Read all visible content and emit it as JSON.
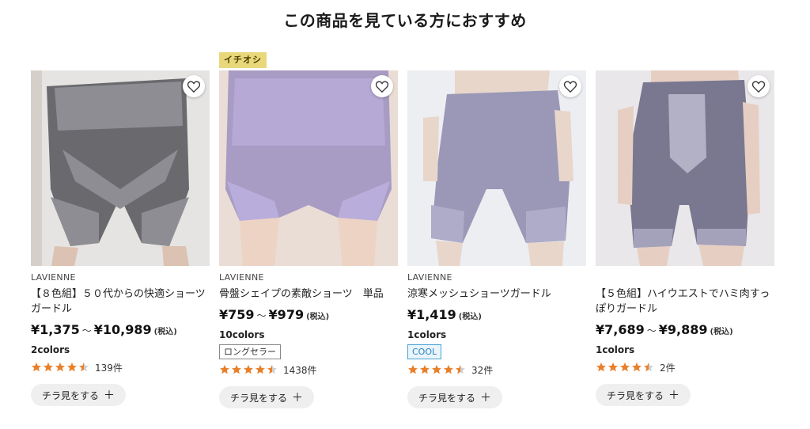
{
  "section": {
    "title": "この商品を見ている方におすすめ"
  },
  "products": [
    {
      "badge": "",
      "brand": "LAVIENNE",
      "name": "【８色組】５０代からの快適ショーツガードル",
      "price_min": "¥1,375",
      "price_sep": "～",
      "price_max": "¥10,989",
      "tax": "(税込)",
      "colors": "2colors",
      "tag": "",
      "rating": 4.5,
      "reviews": "139件",
      "quick_view": "チラ見をする",
      "color": "#6a6a6e"
    },
    {
      "badge": "イチオシ",
      "brand": "LAVIENNE",
      "name": "骨盤シェイプの素敵ショーツ　単品",
      "price_min": "¥759",
      "price_sep": "～",
      "price_max": "¥979",
      "tax": "(税込)",
      "colors": "10colors",
      "tag": "ロングセラー",
      "rating": 4.5,
      "reviews": "1438件",
      "quick_view": "チラ見をする",
      "color": "#a89bc4"
    },
    {
      "badge": "",
      "brand": "LAVIENNE",
      "name": "涼寒メッシュショーツガードル",
      "price_min": "¥1,419",
      "price_sep": "",
      "price_max": "",
      "tax": "(税込)",
      "colors": "1colors",
      "tag": "COOL",
      "rating": 4.5,
      "reviews": "32件",
      "quick_view": "チラ見をする",
      "color": "#9a98b6"
    },
    {
      "badge": "",
      "brand": "",
      "name": "【５色組】ハイウエストでハミ肉すっぽりガードル",
      "price_min": "¥7,689",
      "price_sep": "～",
      "price_max": "¥9,889",
      "tax": "(税込)",
      "colors": "1colors",
      "tag": "",
      "rating": 4.5,
      "reviews": "2件",
      "quick_view": "チラ見をする",
      "color": "#7a7890"
    }
  ],
  "icons": {
    "favorite": "heart-outline-icon",
    "star": "star-icon",
    "plus": "plus-icon"
  },
  "colors": {
    "star": "#e8802a",
    "badge": "#e8d87a",
    "cool": "#2a85c4"
  }
}
